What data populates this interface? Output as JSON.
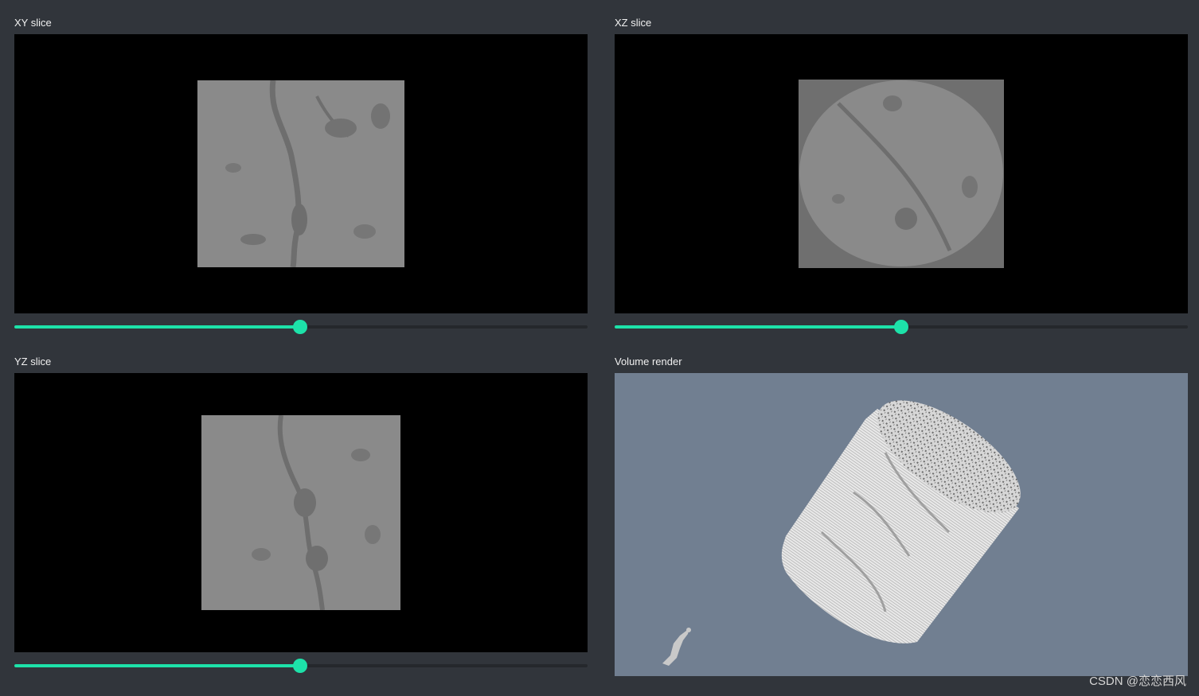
{
  "panels": {
    "xy": {
      "title": "XY slice",
      "slider_value": 0.5
    },
    "xz": {
      "title": "XZ slice",
      "slider_value": 0.5
    },
    "yz": {
      "title": "YZ slice",
      "slider_value": 0.5
    },
    "volume": {
      "title": "Volume render"
    }
  },
  "watermark": "CSDN @恋恋西风",
  "colors": {
    "background": "#31353b",
    "accent": "#1de2a9",
    "volume_background": "#717f91",
    "slice_gray": "#8a8a8a"
  }
}
